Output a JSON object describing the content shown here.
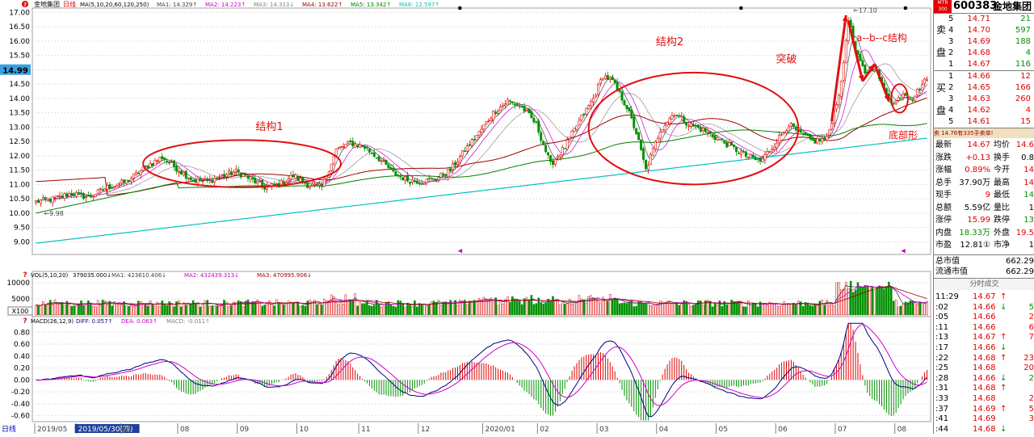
{
  "window": {
    "title": "金地集团",
    "tab_label": "日线",
    "ma_header": {
      "prefix": "MA(5,10,20,60,120,250)",
      "items": [
        {
          "label": "MA1: 14.329",
          "color": "#404040"
        },
        {
          "label": "MA2: 14.223",
          "color": "#cc00cc"
        },
        {
          "label": "MA3: 14.313",
          "color": "#808080"
        },
        {
          "label": "MA4: 13.622",
          "color": "#a00000"
        },
        {
          "label": "MA5: 13.342",
          "color": "#008000"
        },
        {
          "label": "MA6: 12.597",
          "color": "#00c0c0"
        }
      ]
    },
    "current_price_tag": "14.99",
    "high_marker": "17.10",
    "low_marker": "9.98",
    "x100_label": "X100"
  },
  "annotations": {
    "structure1": "结构1",
    "structure2": "结构2",
    "breakout": "突破",
    "abc": "a--b--c结构",
    "bottom": "底部形"
  },
  "volume_header": {
    "prefix": "VOL(5,10,20)",
    "items": [
      {
        "label": "379035.000",
        "color": "#000"
      },
      {
        "label": "MA1: 423610.406",
        "color": "#404040"
      },
      {
        "label": "MA2: 432439.313",
        "color": "#cc00cc"
      },
      {
        "label": "MA3: 470995.906",
        "color": "#a00000"
      }
    ]
  },
  "macd_header": {
    "prefix": "MACD(26,12,9)",
    "items": [
      {
        "label": "DIFF: 0.057",
        "color": "#000080"
      },
      {
        "label": "DEA: 0.063",
        "color": "#cc00cc"
      },
      {
        "label": "MACD: -0.011",
        "color": "#808080"
      }
    ]
  },
  "time_axis": {
    "left_label": "日线",
    "labels": [
      "2019/05",
      "2019/05/30(四)",
      "07",
      "08",
      "09",
      "10",
      "11",
      "12",
      "2020/01",
      "02",
      "03",
      "04",
      "05",
      "06",
      "07",
      "08"
    ]
  },
  "quote": {
    "code": "600383",
    "name": "金地集团",
    "badge": "MTR 300",
    "sell_label": [
      "卖",
      "盘"
    ],
    "buy_label": [
      "买",
      "盘"
    ],
    "asks": [
      {
        "level": "5",
        "price": "14.71",
        "vol": "21"
      },
      {
        "level": "4",
        "price": "14.70",
        "vol": "597"
      },
      {
        "level": "3",
        "price": "14.69",
        "vol": "188"
      },
      {
        "level": "2",
        "price": "14.68",
        "vol": "4"
      },
      {
        "level": "1",
        "price": "14.67",
        "vol": "116"
      }
    ],
    "bids": [
      {
        "level": "1",
        "price": "14.66",
        "vol": "12"
      },
      {
        "level": "2",
        "price": "14.65",
        "vol": "166"
      },
      {
        "level": "3",
        "price": "14.63",
        "vol": "260"
      },
      {
        "level": "4",
        "price": "14.62",
        "vol": "4"
      },
      {
        "level": "5",
        "price": "14.61",
        "vol": "15"
      }
    ],
    "alert": "卖 14.76有335手卖单!",
    "stats": [
      {
        "l1": "最新",
        "v1": "14.67",
        "c1": "red",
        "l2": "均价",
        "v2": "14.6",
        "c2": "red"
      },
      {
        "l1": "涨跌",
        "v1": "+0.13",
        "c1": "red",
        "l2": "换手",
        "v2": "0.8",
        "c2": "blk"
      },
      {
        "l1": "涨幅",
        "v1": "0.89%",
        "c1": "red",
        "l2": "今开",
        "v2": "14",
        "c2": "red"
      },
      {
        "l1": "总手",
        "v1": "37.90万",
        "c1": "blk",
        "l2": "最高",
        "v2": "14",
        "c2": "red"
      },
      {
        "l1": "现手",
        "v1": "9",
        "c1": "red",
        "l2": "最低",
        "v2": "14",
        "c2": "green"
      },
      {
        "l1": "总额",
        "v1": "5.59亿",
        "c1": "blk",
        "l2": "量比",
        "v2": "1",
        "c2": "blk"
      },
      {
        "l1": "涨停",
        "v1": "15.99",
        "c1": "red",
        "l2": "跌停",
        "v2": "13",
        "c2": "green"
      },
      {
        "l1": "内盘",
        "v1": "18.33万",
        "c1": "green",
        "l2": "外盘",
        "v2": "19.5",
        "c2": "red"
      },
      {
        "l1": "市盈",
        "v1": "12.81①",
        "c1": "blk",
        "l2": "市净",
        "v2": "1",
        "c2": "blk"
      }
    ],
    "caps": [
      {
        "label": "总市值",
        "value": "662.29"
      },
      {
        "label": "流通市值",
        "value": "662.29"
      }
    ],
    "ticks_title": "分时成交",
    "ticks": [
      {
        "time": "11:29",
        "price": "14.67",
        "dir": "up",
        "vol": ""
      },
      {
        "time": ":02",
        "price": "14.66",
        "dir": "down",
        "vol": "5"
      },
      {
        "time": ":05",
        "price": "14.66",
        "dir": "",
        "vol": "2"
      },
      {
        "time": ":11",
        "price": "14.66",
        "dir": "",
        "vol": "6"
      },
      {
        "time": ":13",
        "price": "14.67",
        "dir": "up",
        "vol": "7"
      },
      {
        "time": ":17",
        "price": "14.66",
        "dir": "down",
        "vol": ""
      },
      {
        "time": ":22",
        "price": "14.68",
        "dir": "up",
        "vol": "23"
      },
      {
        "time": ":25",
        "price": "14.68",
        "dir": "",
        "vol": "20"
      },
      {
        "time": ":28",
        "price": "14.66",
        "dir": "down",
        "vol": "2"
      },
      {
        "time": ":31",
        "price": "14.68",
        "dir": "up",
        "vol": ""
      },
      {
        "time": ":33",
        "price": "14.68",
        "dir": "",
        "vol": "2"
      },
      {
        "time": ":37",
        "price": "14.69",
        "dir": "up",
        "vol": "5"
      },
      {
        "time": ":41",
        "price": "14.69",
        "dir": "",
        "vol": "3"
      },
      {
        "time": ":44",
        "price": "14.68",
        "dir": "down",
        "vol": ""
      }
    ]
  },
  "chart_data": [
    {
      "type": "candlestick",
      "title": "金地集团 日线",
      "y_ticks": [
        9.0,
        9.5,
        10.0,
        10.5,
        11.0,
        11.5,
        12.0,
        12.5,
        13.0,
        13.5,
        14.0,
        14.5,
        15.0,
        15.5,
        16.0,
        16.5,
        17.0
      ],
      "ylim": [
        8.7,
        17.15
      ],
      "x_range": [
        "2019/05",
        "2020/08"
      ],
      "grid": true,
      "price_keypoints": [
        [
          0,
          10.4
        ],
        [
          8,
          10.5
        ],
        [
          15,
          10.7
        ],
        [
          22,
          10.55
        ],
        [
          30,
          10.9
        ],
        [
          38,
          11.1
        ],
        [
          46,
          11.6
        ],
        [
          53,
          11.95
        ],
        [
          60,
          11.5
        ],
        [
          66,
          11.15
        ],
        [
          72,
          11.1
        ],
        [
          78,
          11.3
        ],
        [
          84,
          11.45
        ],
        [
          90,
          11.2
        ],
        [
          96,
          10.9
        ],
        [
          102,
          11.0
        ],
        [
          108,
          11.3
        ],
        [
          114,
          11.0
        ],
        [
          120,
          10.9
        ],
        [
          126,
          12.2
        ],
        [
          132,
          12.45
        ],
        [
          138,
          12.3
        ],
        [
          144,
          11.9
        ],
        [
          150,
          11.4
        ],
        [
          156,
          11.15
        ],
        [
          162,
          11.1
        ],
        [
          168,
          11.2
        ],
        [
          174,
          11.5
        ],
        [
          180,
          12.2
        ],
        [
          186,
          12.8
        ],
        [
          192,
          13.5
        ],
        [
          198,
          13.9
        ],
        [
          204,
          13.7
        ],
        [
          210,
          13.1
        ],
        [
          216,
          11.7
        ],
        [
          222,
          12.3
        ],
        [
          228,
          13.2
        ],
        [
          234,
          14.0
        ],
        [
          238,
          14.8
        ],
        [
          242,
          14.6
        ],
        [
          248,
          13.7
        ],
        [
          252,
          12.8
        ],
        [
          256,
          11.5
        ],
        [
          262,
          12.9
        ],
        [
          268,
          13.5
        ],
        [
          274,
          13.1
        ],
        [
          280,
          12.9
        ],
        [
          286,
          12.6
        ],
        [
          292,
          12.3
        ],
        [
          298,
          12.0
        ],
        [
          304,
          11.8
        ],
        [
          310,
          12.4
        ],
        [
          316,
          13.1
        ],
        [
          320,
          12.8
        ],
        [
          326,
          12.5
        ],
        [
          332,
          12.6
        ],
        [
          338,
          14.5
        ],
        [
          341,
          16.8
        ],
        [
          344,
          15.6
        ],
        [
          348,
          14.9
        ],
        [
          352,
          15.1
        ],
        [
          356,
          14.3
        ],
        [
          360,
          13.8
        ],
        [
          364,
          14.2
        ],
        [
          368,
          14.0
        ],
        [
          372,
          14.5
        ],
        [
          374,
          14.67
        ]
      ],
      "ma_series": [
        {
          "name": "MA4",
          "color": "#a00000"
        },
        {
          "name": "MA5",
          "color": "#008000"
        },
        {
          "name": "MA6",
          "color": "#00c0c0"
        }
      ],
      "ellipses": [
        {
          "label": "结构1",
          "t": [
            45,
            128
          ],
          "p": [
            10.9,
            12.55
          ]
        },
        {
          "label": "结构2",
          "t": [
            232,
            320
          ],
          "p": [
            11.0,
            14.9
          ]
        },
        {
          "label": "底部形",
          "t": [
            359,
            366
          ],
          "p": [
            13.5,
            14.5
          ]
        }
      ]
    },
    {
      "type": "bar",
      "title": "VOL(5,10,20)",
      "y_ticks": [
        5000,
        10000
      ],
      "ylim": [
        0,
        11000
      ],
      "unit_label": "X100"
    },
    {
      "type": "bar",
      "title": "MACD(26,12,9)",
      "y_ticks": [
        0.8,
        0.6,
        0.4,
        0.2,
        0.0,
        -0.2,
        -0.4,
        -0.6
      ],
      "ylim": [
        -0.7,
        0.98
      ],
      "series": [
        {
          "name": "DIFF",
          "color": "#000080"
        },
        {
          "name": "DEA",
          "color": "#cc00cc"
        }
      ]
    }
  ]
}
